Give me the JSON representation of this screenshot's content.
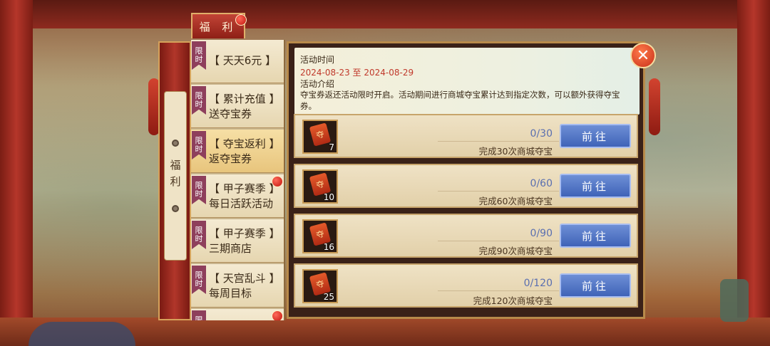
{
  "top_tab": {
    "label": "福 利"
  },
  "scroll_panel": {
    "label": "福利"
  },
  "side_list": [
    {
      "tag": "限\n时",
      "line1": "【 天天6元 】",
      "line2": ""
    },
    {
      "tag": "限\n时",
      "line1": "【 累计充值 】",
      "line2": "送夺宝券"
    },
    {
      "tag": "限\n时",
      "line1": "【 夺宝返利 】",
      "line2": "返夺宝券"
    },
    {
      "tag": "限\n时",
      "line1": "【 甲子赛季 】",
      "line2": "每日活跃活动"
    },
    {
      "tag": "限\n时",
      "line1": "【 甲子赛季 】",
      "line2": "三期商店"
    },
    {
      "tag": "限\n时",
      "line1": "【 天宫乱斗 】",
      "line2": "每周目标"
    },
    {
      "tag": "限\n时",
      "line1": "",
      "line2": ""
    }
  ],
  "info": {
    "time_label": "活动时间",
    "date_range": "2024-08-23 至 2024-08-29",
    "intro_label": "活动介绍",
    "intro_text": "夺宝券返还活动限时开启。活动期间进行商城夺宝累计达到指定次数，可以额外获得夺宝券。"
  },
  "tasks": [
    {
      "icon": "夺",
      "count": "7",
      "progress": "0/30",
      "desc": "完成30次商城夺宝",
      "button": "前往"
    },
    {
      "icon": "夺",
      "count": "10",
      "progress": "0/60",
      "desc": "完成60次商城夺宝",
      "button": "前往"
    },
    {
      "icon": "夺",
      "count": "16",
      "progress": "0/90",
      "desc": "完成90次商城夺宝",
      "button": "前往"
    },
    {
      "icon": "夺",
      "count": "25",
      "progress": "0/120",
      "desc": "完成120次商城夺宝",
      "button": "前往"
    }
  ],
  "close_button": {
    "symbol": "✕"
  }
}
